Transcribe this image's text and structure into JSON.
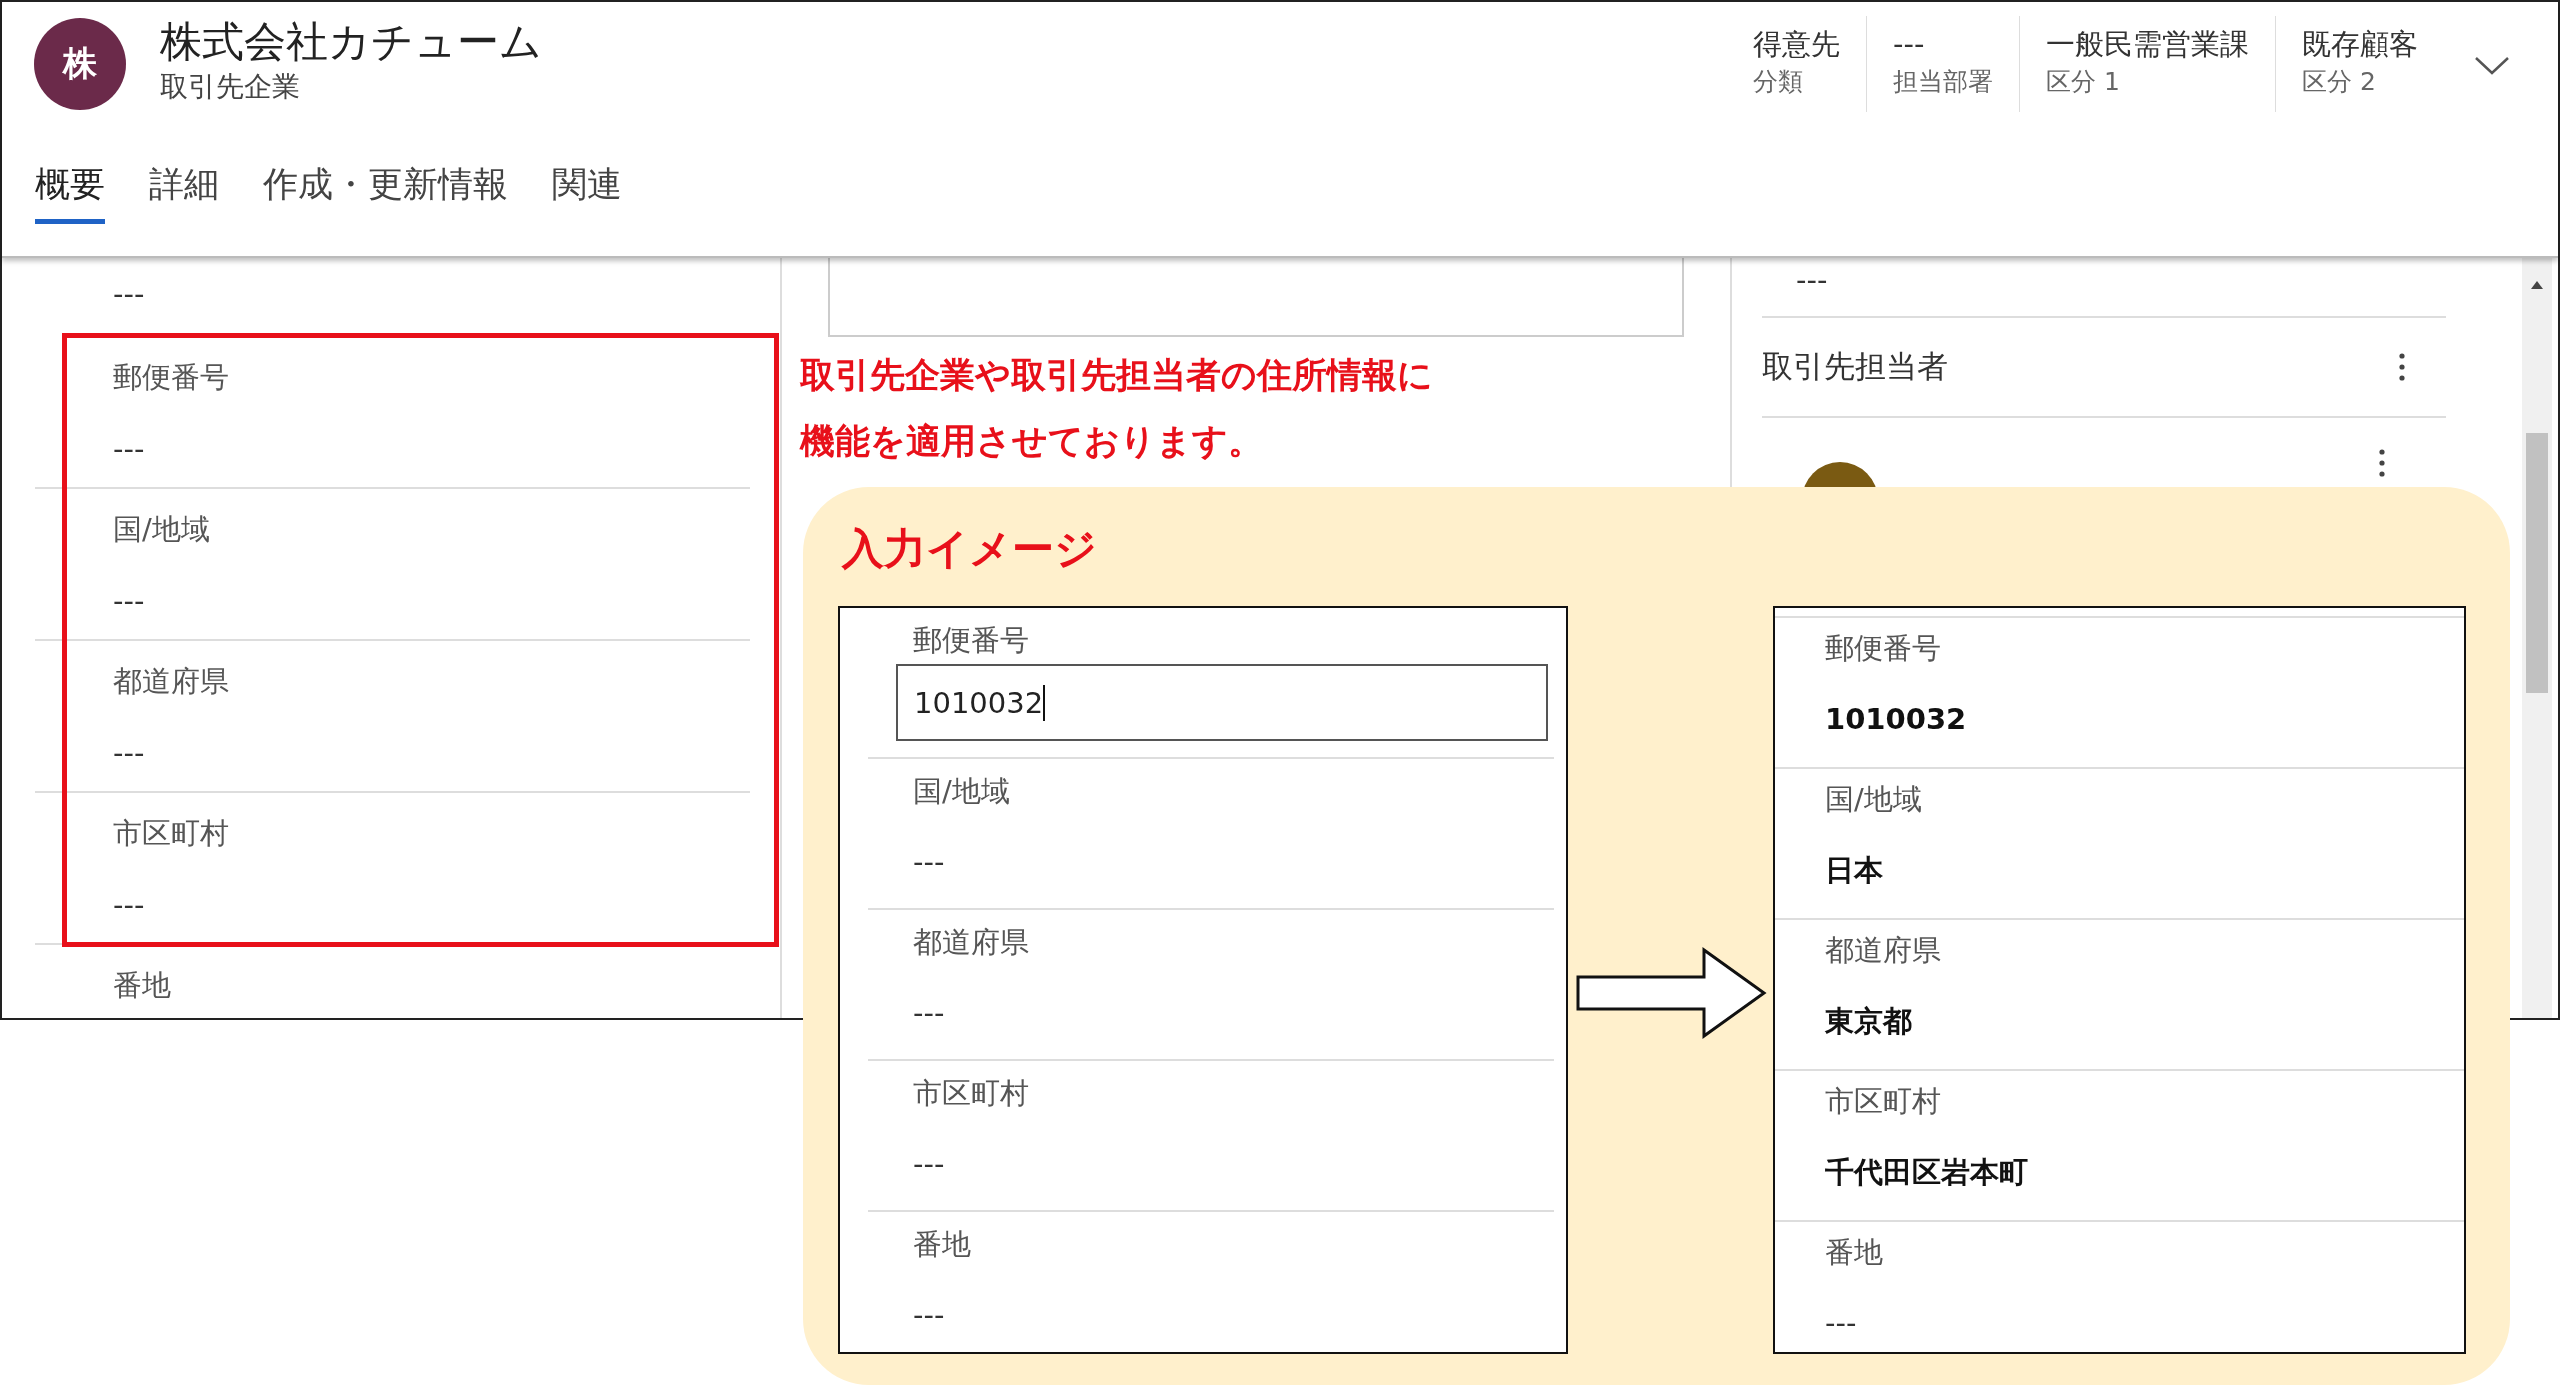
{
  "header": {
    "avatar_initial": "株",
    "title": "株式会社カチューム",
    "subtitle": "取引先企業",
    "fields": [
      {
        "value": "得意先",
        "label": "分類"
      },
      {
        "value": "---",
        "label": "担当部署"
      },
      {
        "value": "一般民需営業課",
        "label": "区分 1"
      },
      {
        "value": "既存顧客",
        "label": "区分 2"
      }
    ]
  },
  "tabs": [
    {
      "label": "概要",
      "selected": true
    },
    {
      "label": "詳細",
      "selected": false
    },
    {
      "label": "作成・更新情報",
      "selected": false
    },
    {
      "label": "関連",
      "selected": false
    }
  ],
  "left_column": {
    "top_value": "---",
    "fields": [
      {
        "label": "郵便番号",
        "value": "---"
      },
      {
        "label": "国/地域",
        "value": "---"
      },
      {
        "label": "都道府県",
        "value": "---"
      },
      {
        "label": "市区町村",
        "value": "---"
      },
      {
        "label": "番地"
      }
    ]
  },
  "right_column": {
    "top_value": "---",
    "section_title": "取引先担当者"
  },
  "annotation": {
    "lines": [
      "取引先企業や取引先担当者の住所情報に",
      "機能を適用させております。"
    ]
  },
  "callout": {
    "title": "入力イメージ",
    "before": [
      {
        "kind": "input",
        "label": "郵便番号",
        "value": "1010032"
      },
      {
        "kind": "empty",
        "label": "国/地域",
        "value": "---"
      },
      {
        "kind": "empty",
        "label": "都道府県",
        "value": "---"
      },
      {
        "kind": "empty",
        "label": "市区町村",
        "value": "---"
      },
      {
        "kind": "empty",
        "label": "番地",
        "value": "---"
      }
    ],
    "after": [
      {
        "kind": "filled",
        "label": "郵便番号",
        "value": "1010032"
      },
      {
        "kind": "filled",
        "label": "国/地域",
        "value": "日本"
      },
      {
        "kind": "filled",
        "label": "都道府県",
        "value": "東京都"
      },
      {
        "kind": "filled",
        "label": "市区町村",
        "value": "千代田区岩本町"
      },
      {
        "kind": "empty",
        "label": "番地",
        "value": "---"
      }
    ]
  }
}
